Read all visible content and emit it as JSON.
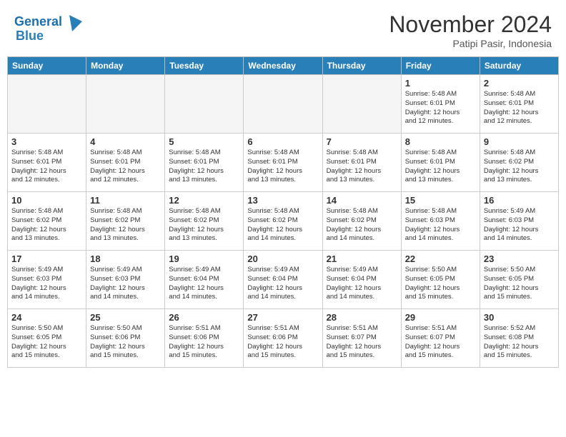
{
  "header": {
    "logo_line1": "General",
    "logo_line2": "Blue",
    "month_title": "November 2024",
    "location": "Patipi Pasir, Indonesia"
  },
  "days_of_week": [
    "Sunday",
    "Monday",
    "Tuesday",
    "Wednesday",
    "Thursday",
    "Friday",
    "Saturday"
  ],
  "weeks": [
    [
      {
        "day": "",
        "info": ""
      },
      {
        "day": "",
        "info": ""
      },
      {
        "day": "",
        "info": ""
      },
      {
        "day": "",
        "info": ""
      },
      {
        "day": "",
        "info": ""
      },
      {
        "day": "1",
        "info": "Sunrise: 5:48 AM\nSunset: 6:01 PM\nDaylight: 12 hours\nand 12 minutes."
      },
      {
        "day": "2",
        "info": "Sunrise: 5:48 AM\nSunset: 6:01 PM\nDaylight: 12 hours\nand 12 minutes."
      }
    ],
    [
      {
        "day": "3",
        "info": "Sunrise: 5:48 AM\nSunset: 6:01 PM\nDaylight: 12 hours\nand 12 minutes."
      },
      {
        "day": "4",
        "info": "Sunrise: 5:48 AM\nSunset: 6:01 PM\nDaylight: 12 hours\nand 12 minutes."
      },
      {
        "day": "5",
        "info": "Sunrise: 5:48 AM\nSunset: 6:01 PM\nDaylight: 12 hours\nand 13 minutes."
      },
      {
        "day": "6",
        "info": "Sunrise: 5:48 AM\nSunset: 6:01 PM\nDaylight: 12 hours\nand 13 minutes."
      },
      {
        "day": "7",
        "info": "Sunrise: 5:48 AM\nSunset: 6:01 PM\nDaylight: 12 hours\nand 13 minutes."
      },
      {
        "day": "8",
        "info": "Sunrise: 5:48 AM\nSunset: 6:01 PM\nDaylight: 12 hours\nand 13 minutes."
      },
      {
        "day": "9",
        "info": "Sunrise: 5:48 AM\nSunset: 6:02 PM\nDaylight: 12 hours\nand 13 minutes."
      }
    ],
    [
      {
        "day": "10",
        "info": "Sunrise: 5:48 AM\nSunset: 6:02 PM\nDaylight: 12 hours\nand 13 minutes."
      },
      {
        "day": "11",
        "info": "Sunrise: 5:48 AM\nSunset: 6:02 PM\nDaylight: 12 hours\nand 13 minutes."
      },
      {
        "day": "12",
        "info": "Sunrise: 5:48 AM\nSunset: 6:02 PM\nDaylight: 12 hours\nand 13 minutes."
      },
      {
        "day": "13",
        "info": "Sunrise: 5:48 AM\nSunset: 6:02 PM\nDaylight: 12 hours\nand 14 minutes."
      },
      {
        "day": "14",
        "info": "Sunrise: 5:48 AM\nSunset: 6:02 PM\nDaylight: 12 hours\nand 14 minutes."
      },
      {
        "day": "15",
        "info": "Sunrise: 5:48 AM\nSunset: 6:03 PM\nDaylight: 12 hours\nand 14 minutes."
      },
      {
        "day": "16",
        "info": "Sunrise: 5:49 AM\nSunset: 6:03 PM\nDaylight: 12 hours\nand 14 minutes."
      }
    ],
    [
      {
        "day": "17",
        "info": "Sunrise: 5:49 AM\nSunset: 6:03 PM\nDaylight: 12 hours\nand 14 minutes."
      },
      {
        "day": "18",
        "info": "Sunrise: 5:49 AM\nSunset: 6:03 PM\nDaylight: 12 hours\nand 14 minutes."
      },
      {
        "day": "19",
        "info": "Sunrise: 5:49 AM\nSunset: 6:04 PM\nDaylight: 12 hours\nand 14 minutes."
      },
      {
        "day": "20",
        "info": "Sunrise: 5:49 AM\nSunset: 6:04 PM\nDaylight: 12 hours\nand 14 minutes."
      },
      {
        "day": "21",
        "info": "Sunrise: 5:49 AM\nSunset: 6:04 PM\nDaylight: 12 hours\nand 14 minutes."
      },
      {
        "day": "22",
        "info": "Sunrise: 5:50 AM\nSunset: 6:05 PM\nDaylight: 12 hours\nand 15 minutes."
      },
      {
        "day": "23",
        "info": "Sunrise: 5:50 AM\nSunset: 6:05 PM\nDaylight: 12 hours\nand 15 minutes."
      }
    ],
    [
      {
        "day": "24",
        "info": "Sunrise: 5:50 AM\nSunset: 6:05 PM\nDaylight: 12 hours\nand 15 minutes."
      },
      {
        "day": "25",
        "info": "Sunrise: 5:50 AM\nSunset: 6:06 PM\nDaylight: 12 hours\nand 15 minutes."
      },
      {
        "day": "26",
        "info": "Sunrise: 5:51 AM\nSunset: 6:06 PM\nDaylight: 12 hours\nand 15 minutes."
      },
      {
        "day": "27",
        "info": "Sunrise: 5:51 AM\nSunset: 6:06 PM\nDaylight: 12 hours\nand 15 minutes."
      },
      {
        "day": "28",
        "info": "Sunrise: 5:51 AM\nSunset: 6:07 PM\nDaylight: 12 hours\nand 15 minutes."
      },
      {
        "day": "29",
        "info": "Sunrise: 5:51 AM\nSunset: 6:07 PM\nDaylight: 12 hours\nand 15 minutes."
      },
      {
        "day": "30",
        "info": "Sunrise: 5:52 AM\nSunset: 6:08 PM\nDaylight: 12 hours\nand 15 minutes."
      }
    ]
  ]
}
